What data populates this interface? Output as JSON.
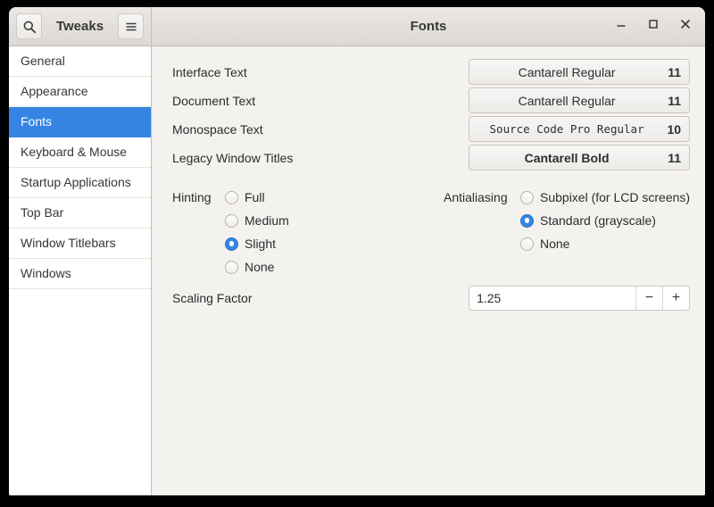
{
  "app": {
    "title": "Tweaks",
    "page_title": "Fonts"
  },
  "accent_color": "#3584e4",
  "icons": {
    "search": "magnifier",
    "menu": "hamburger",
    "minimize": "minus",
    "maximize": "square-outline",
    "close": "x-cross",
    "spin_decrement": "−",
    "spin_increment": "+"
  },
  "sidebar": {
    "items": [
      {
        "label": "General",
        "selected": false
      },
      {
        "label": "Appearance",
        "selected": false
      },
      {
        "label": "Fonts",
        "selected": true
      },
      {
        "label": "Keyboard & Mouse",
        "selected": false
      },
      {
        "label": "Startup Applications",
        "selected": false
      },
      {
        "label": "Top Bar",
        "selected": false
      },
      {
        "label": "Window Titlebars",
        "selected": false
      },
      {
        "label": "Windows",
        "selected": false
      }
    ]
  },
  "font_rows": [
    {
      "label": "Interface Text",
      "font_name": "Cantarell Regular",
      "size": "11"
    },
    {
      "label": "Document Text",
      "font_name": "Cantarell Regular",
      "size": "11"
    },
    {
      "label": "Monospace Text",
      "font_name": "Source Code Pro Regular",
      "size": "10"
    },
    {
      "label": "Legacy Window Titles",
      "font_name": "Cantarell Bold",
      "size": "11"
    }
  ],
  "hinting": {
    "label": "Hinting",
    "options": [
      {
        "label": "Full",
        "selected": false
      },
      {
        "label": "Medium",
        "selected": false
      },
      {
        "label": "Slight",
        "selected": true
      },
      {
        "label": "None",
        "selected": false
      }
    ]
  },
  "antialiasing": {
    "label": "Antialiasing",
    "options": [
      {
        "label": "Subpixel (for LCD screens)",
        "selected": false
      },
      {
        "label": "Standard (grayscale)",
        "selected": true
      },
      {
        "label": "None",
        "selected": false
      }
    ]
  },
  "scaling": {
    "label": "Scaling Factor",
    "value": "1.25"
  }
}
